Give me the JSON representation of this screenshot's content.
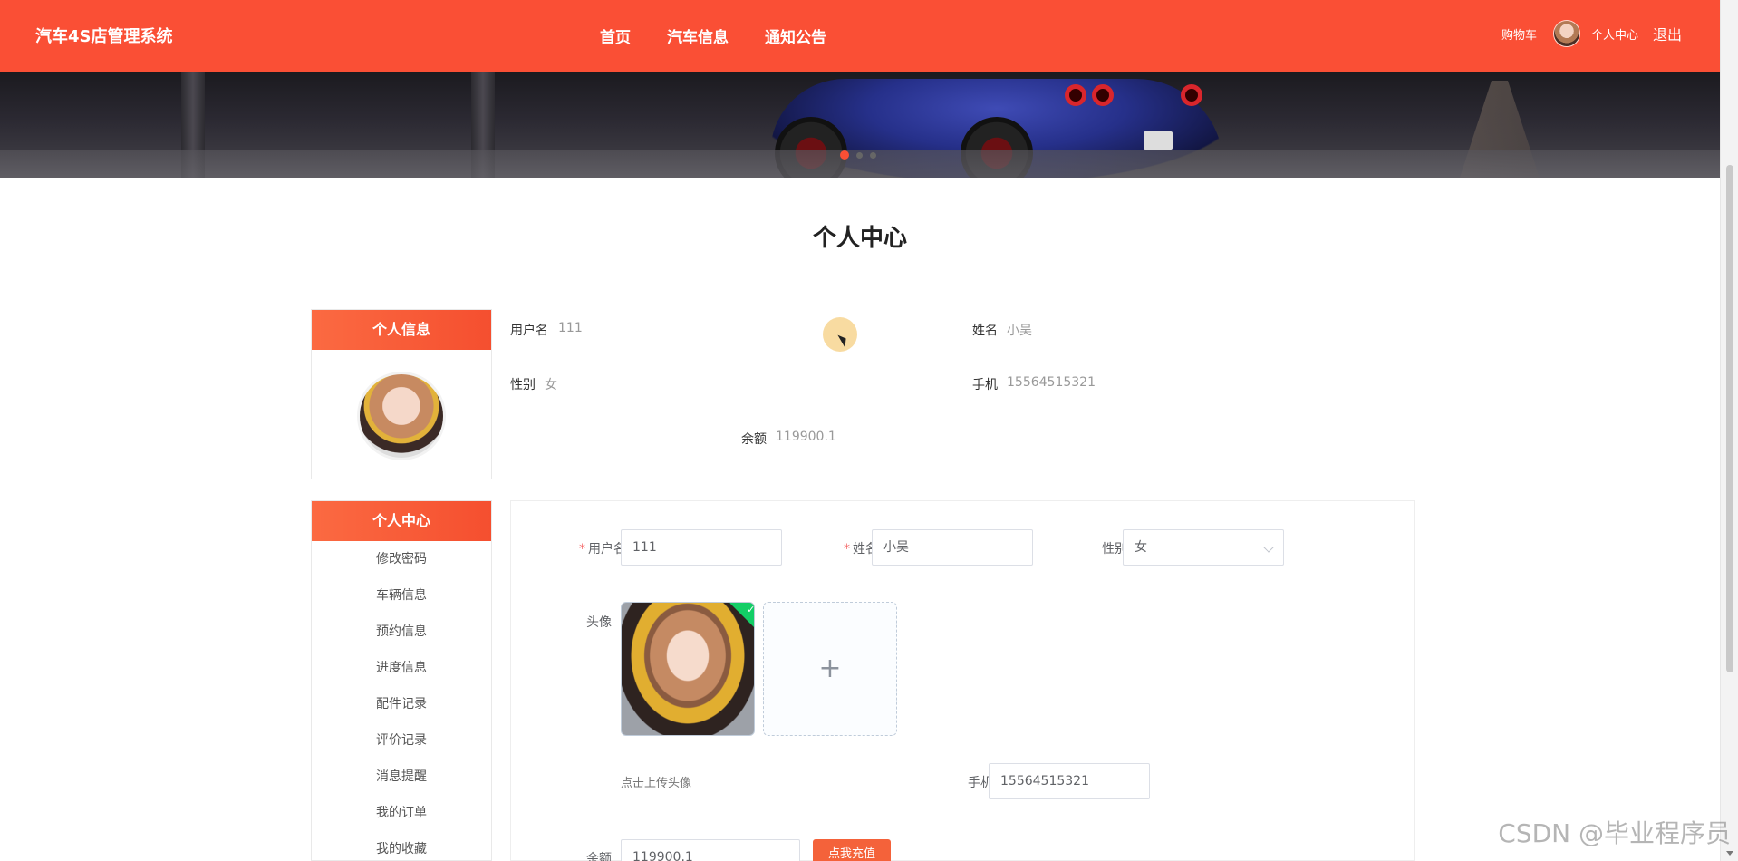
{
  "header": {
    "brand": "汽车4S店管理系统",
    "nav": [
      "首页",
      "汽车信息",
      "通知公告"
    ],
    "cart": "购物车",
    "profile": "个人中心",
    "logout": "退出"
  },
  "page_title": "个人中心",
  "info_panel": {
    "title": "个人信息",
    "fields": {
      "username_label": "用户名",
      "username": "111",
      "name_label": "姓名",
      "name": "小吴",
      "gender_label": "性别",
      "gender": "女",
      "phone_label": "手机",
      "phone": "15564515321",
      "balance_label": "余额",
      "balance": "119900.1"
    }
  },
  "menu": {
    "title": "个人中心",
    "items": [
      "修改密码",
      "车辆信息",
      "预约信息",
      "进度信息",
      "配件记录",
      "评价记录",
      "消息提醒",
      "我的订单",
      "我的收藏"
    ]
  },
  "form": {
    "username_label": "用户名",
    "username_value": "111",
    "name_label": "姓名",
    "name_value": "小吴",
    "gender_label": "性别",
    "gender_value": "女",
    "avatar_label": "头像",
    "upload_plus": "+",
    "upload_tip": "点击上传头像",
    "phone_label": "手机",
    "phone_value": "15564515321",
    "balance_label": "余额",
    "balance_value": "119900.1",
    "recharge_button": "点我充值",
    "required_mark": "*",
    "check_mark": "✓"
  },
  "watermark": "CSDN @毕业程序员",
  "colors": {
    "primary": "#fa4f35",
    "success": "#13ce66"
  }
}
